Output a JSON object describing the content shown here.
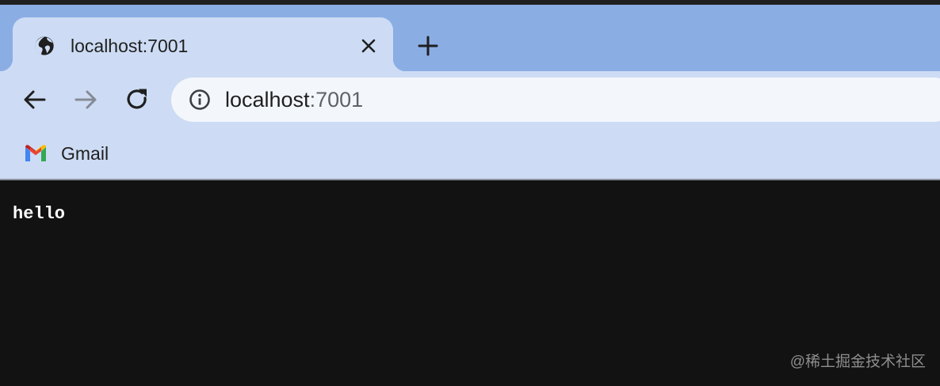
{
  "browser": {
    "tab": {
      "title": "localhost:7001",
      "favicon": "globe-icon",
      "close_icon": "close-icon"
    },
    "new_tab_icon": "plus-icon",
    "nav": {
      "back_icon": "arrow-left-icon",
      "forward_icon": "arrow-right-icon",
      "reload_icon": "reload-icon"
    },
    "omnibox": {
      "host": "localhost",
      "port": ":7001",
      "info_icon": "info-icon"
    },
    "bookmarks": [
      {
        "label": "Gmail",
        "icon": "gmail-icon"
      }
    ]
  },
  "page": {
    "body_text": "hello"
  },
  "watermark": "@稀土掘金技术社区",
  "colors": {
    "tabstrip": "#8aade4",
    "toolbar": "#cddcf4",
    "omnibox": "#f3f7fc",
    "page_background": "#121212",
    "page_text": "#ffffff"
  }
}
